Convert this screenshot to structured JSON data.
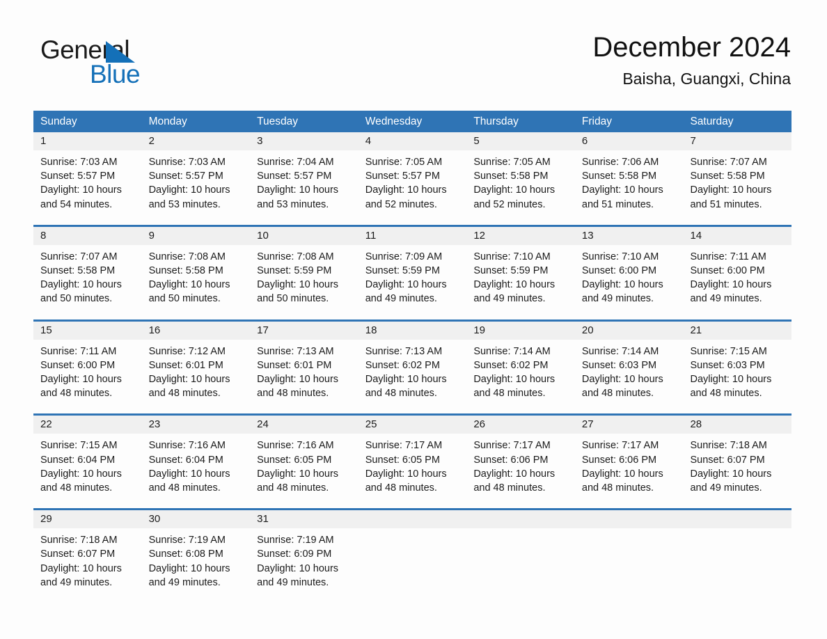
{
  "brand": {
    "name_top": "General",
    "name_bottom": "Blue",
    "triangle_color": "#1470b8",
    "text_color": "#1b1b1b"
  },
  "header": {
    "title": "December 2024",
    "subtitle": "Baisha, Guangxi, China"
  },
  "theme": {
    "accent": "#2f74b5",
    "daynum_bg": "#f0f0f0",
    "page_bg": "#fdfdfd",
    "text": "#1b1b1b"
  },
  "calendar": {
    "weekdays": [
      "Sunday",
      "Monday",
      "Tuesday",
      "Wednesday",
      "Thursday",
      "Friday",
      "Saturday"
    ],
    "weeks": [
      [
        {
          "day": "1",
          "sunrise": "Sunrise: 7:03 AM",
          "sunset": "Sunset: 5:57 PM",
          "daylight": "Daylight: 10 hours and 54 minutes."
        },
        {
          "day": "2",
          "sunrise": "Sunrise: 7:03 AM",
          "sunset": "Sunset: 5:57 PM",
          "daylight": "Daylight: 10 hours and 53 minutes."
        },
        {
          "day": "3",
          "sunrise": "Sunrise: 7:04 AM",
          "sunset": "Sunset: 5:57 PM",
          "daylight": "Daylight: 10 hours and 53 minutes."
        },
        {
          "day": "4",
          "sunrise": "Sunrise: 7:05 AM",
          "sunset": "Sunset: 5:57 PM",
          "daylight": "Daylight: 10 hours and 52 minutes."
        },
        {
          "day": "5",
          "sunrise": "Sunrise: 7:05 AM",
          "sunset": "Sunset: 5:58 PM",
          "daylight": "Daylight: 10 hours and 52 minutes."
        },
        {
          "day": "6",
          "sunrise": "Sunrise: 7:06 AM",
          "sunset": "Sunset: 5:58 PM",
          "daylight": "Daylight: 10 hours and 51 minutes."
        },
        {
          "day": "7",
          "sunrise": "Sunrise: 7:07 AM",
          "sunset": "Sunset: 5:58 PM",
          "daylight": "Daylight: 10 hours and 51 minutes."
        }
      ],
      [
        {
          "day": "8",
          "sunrise": "Sunrise: 7:07 AM",
          "sunset": "Sunset: 5:58 PM",
          "daylight": "Daylight: 10 hours and 50 minutes."
        },
        {
          "day": "9",
          "sunrise": "Sunrise: 7:08 AM",
          "sunset": "Sunset: 5:58 PM",
          "daylight": "Daylight: 10 hours and 50 minutes."
        },
        {
          "day": "10",
          "sunrise": "Sunrise: 7:08 AM",
          "sunset": "Sunset: 5:59 PM",
          "daylight": "Daylight: 10 hours and 50 minutes."
        },
        {
          "day": "11",
          "sunrise": "Sunrise: 7:09 AM",
          "sunset": "Sunset: 5:59 PM",
          "daylight": "Daylight: 10 hours and 49 minutes."
        },
        {
          "day": "12",
          "sunrise": "Sunrise: 7:10 AM",
          "sunset": "Sunset: 5:59 PM",
          "daylight": "Daylight: 10 hours and 49 minutes."
        },
        {
          "day": "13",
          "sunrise": "Sunrise: 7:10 AM",
          "sunset": "Sunset: 6:00 PM",
          "daylight": "Daylight: 10 hours and 49 minutes."
        },
        {
          "day": "14",
          "sunrise": "Sunrise: 7:11 AM",
          "sunset": "Sunset: 6:00 PM",
          "daylight": "Daylight: 10 hours and 49 minutes."
        }
      ],
      [
        {
          "day": "15",
          "sunrise": "Sunrise: 7:11 AM",
          "sunset": "Sunset: 6:00 PM",
          "daylight": "Daylight: 10 hours and 48 minutes."
        },
        {
          "day": "16",
          "sunrise": "Sunrise: 7:12 AM",
          "sunset": "Sunset: 6:01 PM",
          "daylight": "Daylight: 10 hours and 48 minutes."
        },
        {
          "day": "17",
          "sunrise": "Sunrise: 7:13 AM",
          "sunset": "Sunset: 6:01 PM",
          "daylight": "Daylight: 10 hours and 48 minutes."
        },
        {
          "day": "18",
          "sunrise": "Sunrise: 7:13 AM",
          "sunset": "Sunset: 6:02 PM",
          "daylight": "Daylight: 10 hours and 48 minutes."
        },
        {
          "day": "19",
          "sunrise": "Sunrise: 7:14 AM",
          "sunset": "Sunset: 6:02 PM",
          "daylight": "Daylight: 10 hours and 48 minutes."
        },
        {
          "day": "20",
          "sunrise": "Sunrise: 7:14 AM",
          "sunset": "Sunset: 6:03 PM",
          "daylight": "Daylight: 10 hours and 48 minutes."
        },
        {
          "day": "21",
          "sunrise": "Sunrise: 7:15 AM",
          "sunset": "Sunset: 6:03 PM",
          "daylight": "Daylight: 10 hours and 48 minutes."
        }
      ],
      [
        {
          "day": "22",
          "sunrise": "Sunrise: 7:15 AM",
          "sunset": "Sunset: 6:04 PM",
          "daylight": "Daylight: 10 hours and 48 minutes."
        },
        {
          "day": "23",
          "sunrise": "Sunrise: 7:16 AM",
          "sunset": "Sunset: 6:04 PM",
          "daylight": "Daylight: 10 hours and 48 minutes."
        },
        {
          "day": "24",
          "sunrise": "Sunrise: 7:16 AM",
          "sunset": "Sunset: 6:05 PM",
          "daylight": "Daylight: 10 hours and 48 minutes."
        },
        {
          "day": "25",
          "sunrise": "Sunrise: 7:17 AM",
          "sunset": "Sunset: 6:05 PM",
          "daylight": "Daylight: 10 hours and 48 minutes."
        },
        {
          "day": "26",
          "sunrise": "Sunrise: 7:17 AM",
          "sunset": "Sunset: 6:06 PM",
          "daylight": "Daylight: 10 hours and 48 minutes."
        },
        {
          "day": "27",
          "sunrise": "Sunrise: 7:17 AM",
          "sunset": "Sunset: 6:06 PM",
          "daylight": "Daylight: 10 hours and 48 minutes."
        },
        {
          "day": "28",
          "sunrise": "Sunrise: 7:18 AM",
          "sunset": "Sunset: 6:07 PM",
          "daylight": "Daylight: 10 hours and 49 minutes."
        }
      ],
      [
        {
          "day": "29",
          "sunrise": "Sunrise: 7:18 AM",
          "sunset": "Sunset: 6:07 PM",
          "daylight": "Daylight: 10 hours and 49 minutes."
        },
        {
          "day": "30",
          "sunrise": "Sunrise: 7:19 AM",
          "sunset": "Sunset: 6:08 PM",
          "daylight": "Daylight: 10 hours and 49 minutes."
        },
        {
          "day": "31",
          "sunrise": "Sunrise: 7:19 AM",
          "sunset": "Sunset: 6:09 PM",
          "daylight": "Daylight: 10 hours and 49 minutes."
        },
        {
          "day": "",
          "sunrise": "",
          "sunset": "",
          "daylight": ""
        },
        {
          "day": "",
          "sunrise": "",
          "sunset": "",
          "daylight": ""
        },
        {
          "day": "",
          "sunrise": "",
          "sunset": "",
          "daylight": ""
        },
        {
          "day": "",
          "sunrise": "",
          "sunset": "",
          "daylight": ""
        }
      ]
    ]
  }
}
